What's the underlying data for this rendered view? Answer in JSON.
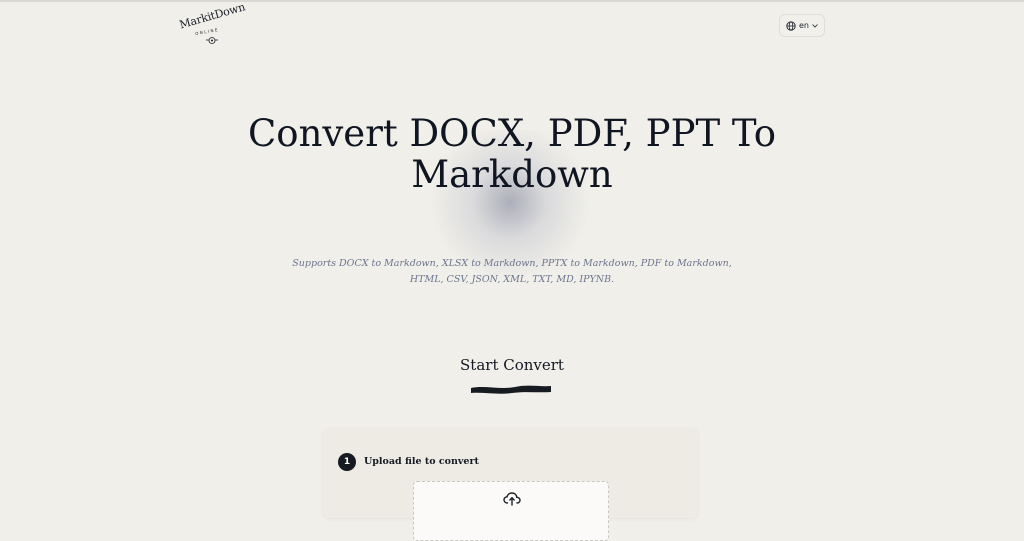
{
  "header": {
    "logo": {
      "name": "MarkitDown",
      "sub": "ONLINE"
    },
    "language": {
      "value": "en",
      "globe_icon": "globe-icon",
      "chevron_icon": "chevron-down-icon"
    }
  },
  "hero": {
    "title": "Convert DOCX, PDF, PPT To Markdown",
    "subtitle": "Supports DOCX to Markdown, XLSX to Markdown, PPTX to Markdown, PDF to Markdown, HTML, CSV, JSON, XML, TXT, MD, IPYNB."
  },
  "convert": {
    "title": "Start Convert",
    "steps": [
      {
        "number": "1",
        "label": "Upload file to convert",
        "icon": "cloud-upload-icon"
      }
    ]
  },
  "colors": {
    "background": "#f0efe9",
    "text": "#101522",
    "muted": "#6b7590",
    "card": "#eeebe5",
    "accent": "#161b22"
  }
}
